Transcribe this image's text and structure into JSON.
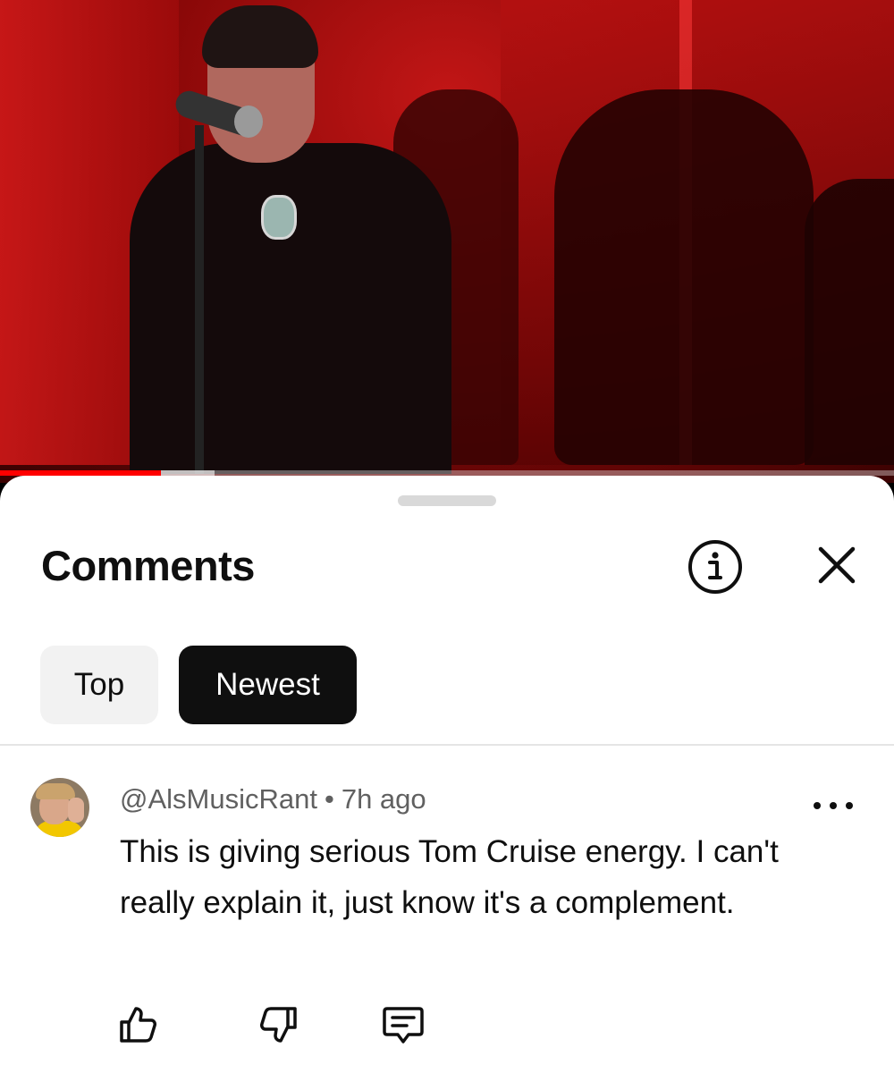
{
  "video": {
    "progress_played_fraction": 0.18,
    "progress_buffered_fraction": 0.24
  },
  "sheet": {
    "title": "Comments",
    "icons": {
      "info": "info-icon",
      "close": "close-icon"
    }
  },
  "filters": {
    "top_label": "Top",
    "newest_label": "Newest",
    "selected": "Newest"
  },
  "comment": {
    "author": "@AlsMusicRant",
    "separator": "•",
    "time": "7h ago",
    "text": "This is giving serious Tom Cruise energy. I can't really explain it, just know it's a complement.",
    "icons": {
      "more": "more-vertical-icon",
      "like": "thumbs-up-icon",
      "dislike": "thumbs-down-icon",
      "reply": "reply-icon"
    }
  },
  "colors": {
    "accent": "#ff0000",
    "chip_selected_bg": "#0f0f0f",
    "chip_bg": "#f2f2f2",
    "meta_text": "#606060"
  }
}
